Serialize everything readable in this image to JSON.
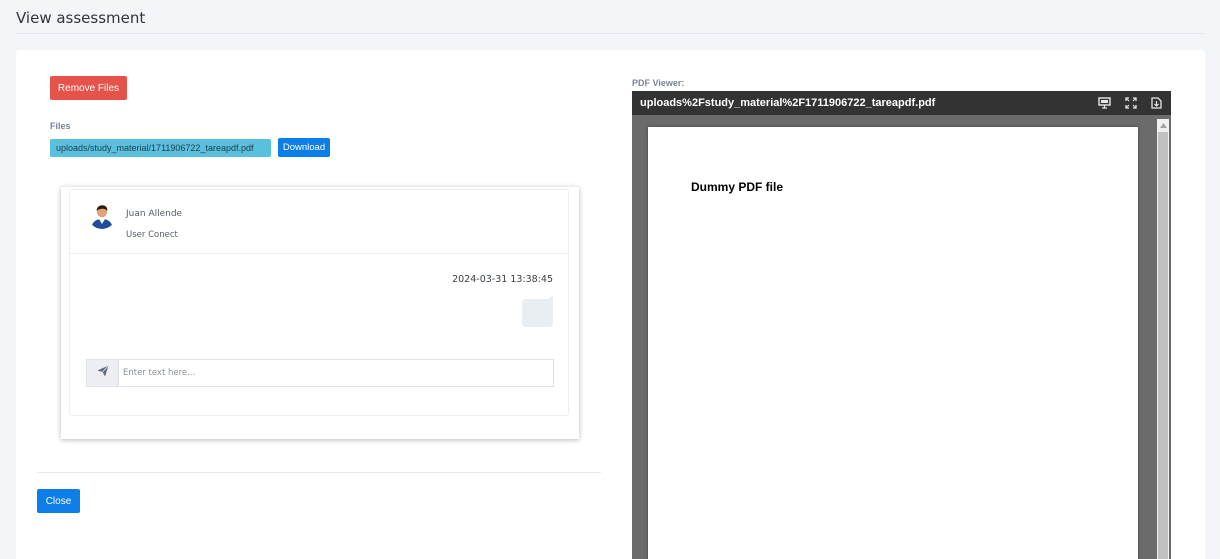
{
  "header": {
    "title": "View assessment"
  },
  "left": {
    "remove_files_label": "Remove Files",
    "files_label": "Files",
    "file_name": "uploads/study_material/1711906722_tareapdf.pdf",
    "download_label": "Download"
  },
  "chat": {
    "user_name": "Juan Allende",
    "user_status": "User Conect",
    "timestamp": "2024-03-31 13:38:45",
    "input_placeholder": "Enter text here...",
    "input_value": ""
  },
  "footer": {
    "close_label": "Close"
  },
  "pdf": {
    "label": "PDF Viewer:",
    "filename": "uploads%2Fstudy_material%2F1711906722_tareapdf.pdf",
    "page_text": "Dummy PDF file",
    "tools": [
      "presentation-icon",
      "fullscreen-icon",
      "download-icon"
    ]
  },
  "colors": {
    "danger": "#e5534b",
    "primary": "#0d7ee8",
    "info": "#5bc0de",
    "pdf_toolbar": "#333333"
  }
}
